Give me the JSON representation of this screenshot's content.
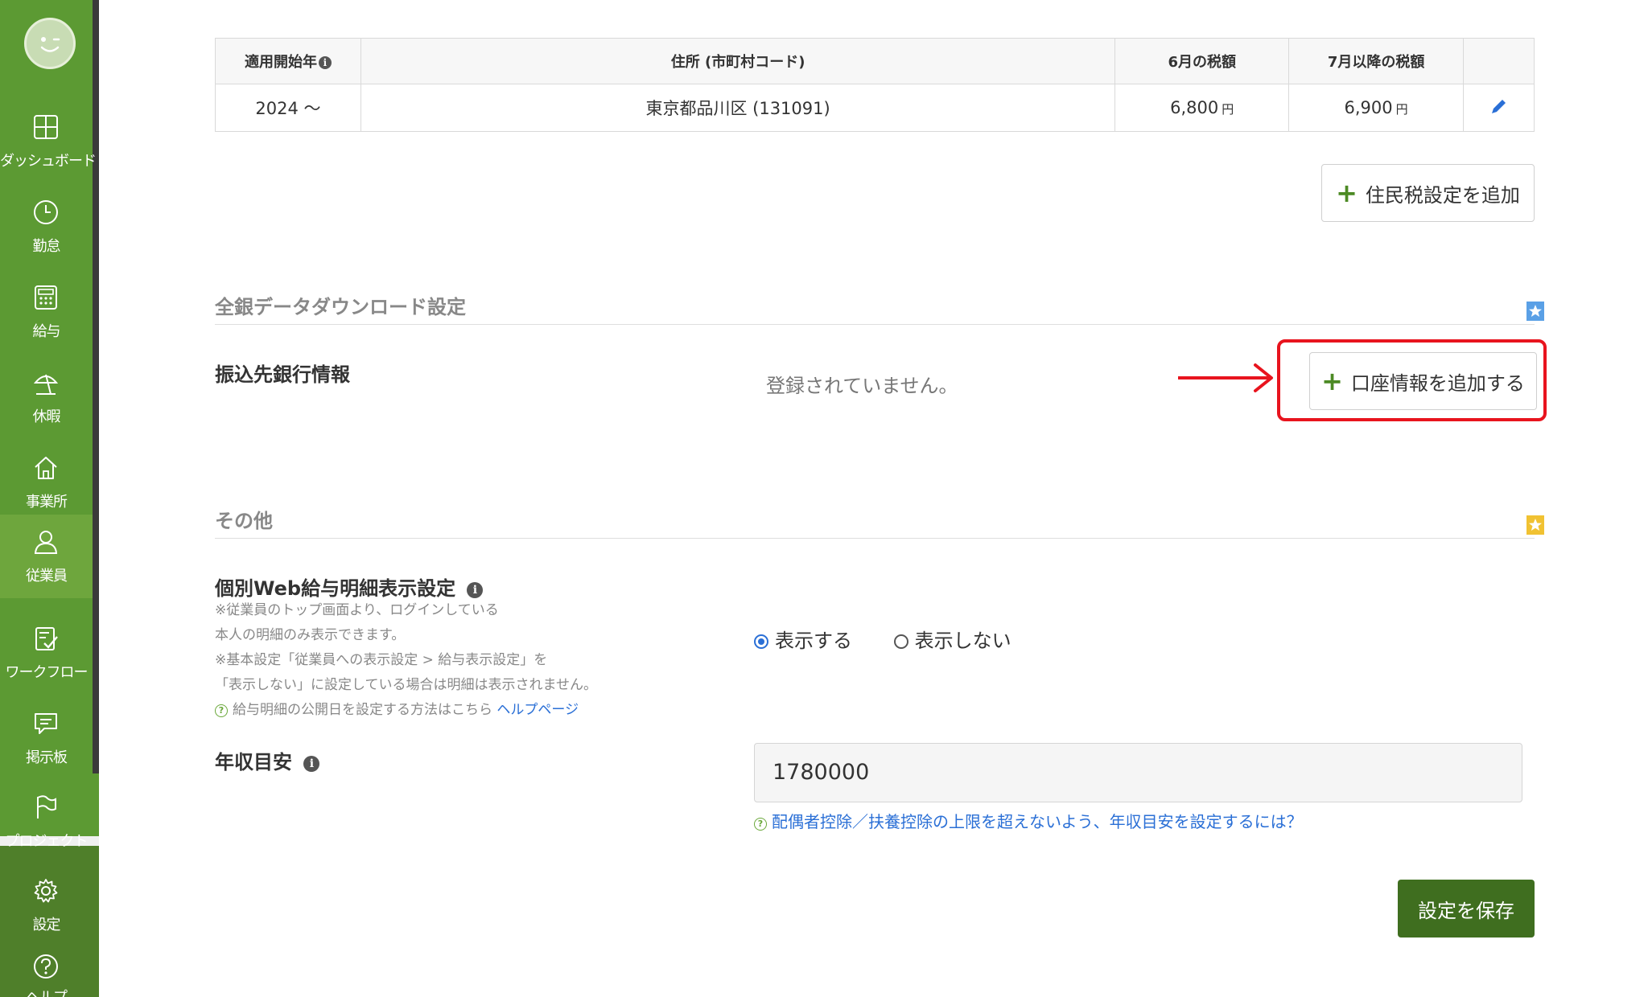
{
  "sidebar": {
    "items": [
      {
        "label": "ダッシュボード",
        "icon": "dashboard-icon"
      },
      {
        "label": "勤怠",
        "icon": "clock-icon"
      },
      {
        "label": "給与",
        "icon": "calculator-icon"
      },
      {
        "label": "休暇",
        "icon": "parasol-icon"
      },
      {
        "label": "事業所",
        "icon": "home-icon"
      },
      {
        "label": "従業員",
        "icon": "person-icon",
        "active": true
      },
      {
        "label": "ワークフロー",
        "icon": "document-check-icon"
      },
      {
        "label": "掲示板",
        "icon": "chat-icon"
      },
      {
        "label": "プロジェクト",
        "icon": "flag-icon"
      },
      {
        "label": "設定",
        "icon": "gear-icon"
      },
      {
        "label": "ヘルプ",
        "icon": "help-icon"
      }
    ]
  },
  "tax_table": {
    "headers": [
      "適用開始年",
      "住所 (市町村コード)",
      "6月の税額",
      "7月以降の税額"
    ],
    "rows": [
      {
        "start_year": "2024 〜",
        "address": "東京都品川区 (131091)",
        "june_tax": "6,800",
        "july_tax": "6,900",
        "unit": "円"
      }
    ],
    "info_glyph": "i"
  },
  "add_resident_tax_button": "住民税設定を追加",
  "bank_section": {
    "title": "全銀データダウンロード設定",
    "label": "振込先銀行情報",
    "status": "登録されていません。",
    "add_button": "口座情報を追加する"
  },
  "other_section": {
    "title": "その他",
    "web_payslip": {
      "label": "個別Web給与明細表示設定",
      "notes": [
        "※従業員のトップ画面より、ログインしている",
        "本人の明細のみ表示できます。",
        "※基本設定「従業員への表示設定 > 給与表示設定」を",
        "「表示しない」に設定している場合は明細は表示されません。"
      ],
      "help_text": "給与明細の公開日を設定する方法はこちら",
      "help_link": "ヘルプページ",
      "options": [
        "表示する",
        "表示しない"
      ],
      "selected": "表示する"
    },
    "annual_income": {
      "label": "年収目安",
      "value": "1780000",
      "help_link": "配偶者控除／扶養控除の上限を超えないよう、年収目安を設定するには？"
    }
  },
  "save_button": "設定を保存",
  "colors": {
    "sidebar": "#5c9a33",
    "save": "#3f6e1f",
    "link": "#2a6fd6",
    "highlight": "#e8141e"
  }
}
